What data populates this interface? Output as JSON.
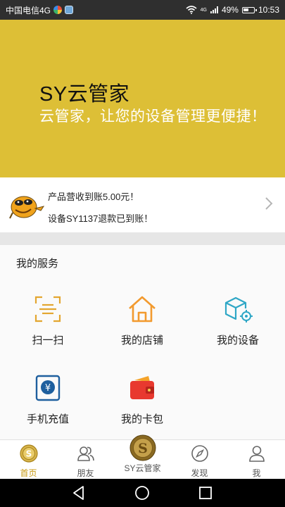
{
  "status_bar": {
    "carrier": "中国电信4G",
    "network": "4G",
    "battery": "49%",
    "time": "10:53"
  },
  "banner": {
    "title": "SY云管家",
    "subtitle": "云管家，让您的设备管理更便捷！",
    "background_color": "#ddbf36"
  },
  "notice": {
    "line1": "产品营收到账5.00元！",
    "line2": "设备SY1137退款已到账！"
  },
  "services": {
    "title": "我的服务",
    "items": [
      {
        "label": "扫一扫",
        "icon": "scan-icon"
      },
      {
        "label": "我的店铺",
        "icon": "shop-icon"
      },
      {
        "label": "我的设备",
        "icon": "device-icon"
      },
      {
        "label": "手机充值",
        "icon": "recharge-icon"
      },
      {
        "label": "我的卡包",
        "icon": "wallet-icon"
      }
    ]
  },
  "tabbar": {
    "items": [
      {
        "label": "首页",
        "icon": "home-coin-icon",
        "active": true
      },
      {
        "label": "朋友",
        "icon": "friends-icon",
        "active": false
      },
      {
        "label": "SY云管家",
        "icon": "sy-coin-icon",
        "active": false
      },
      {
        "label": "发现",
        "icon": "compass-icon",
        "active": false
      },
      {
        "label": "我",
        "icon": "person-icon",
        "active": false
      }
    ],
    "accent_color": "#c89a12"
  },
  "system_nav": {
    "buttons": [
      "back-icon",
      "home-icon",
      "recents-icon"
    ]
  }
}
